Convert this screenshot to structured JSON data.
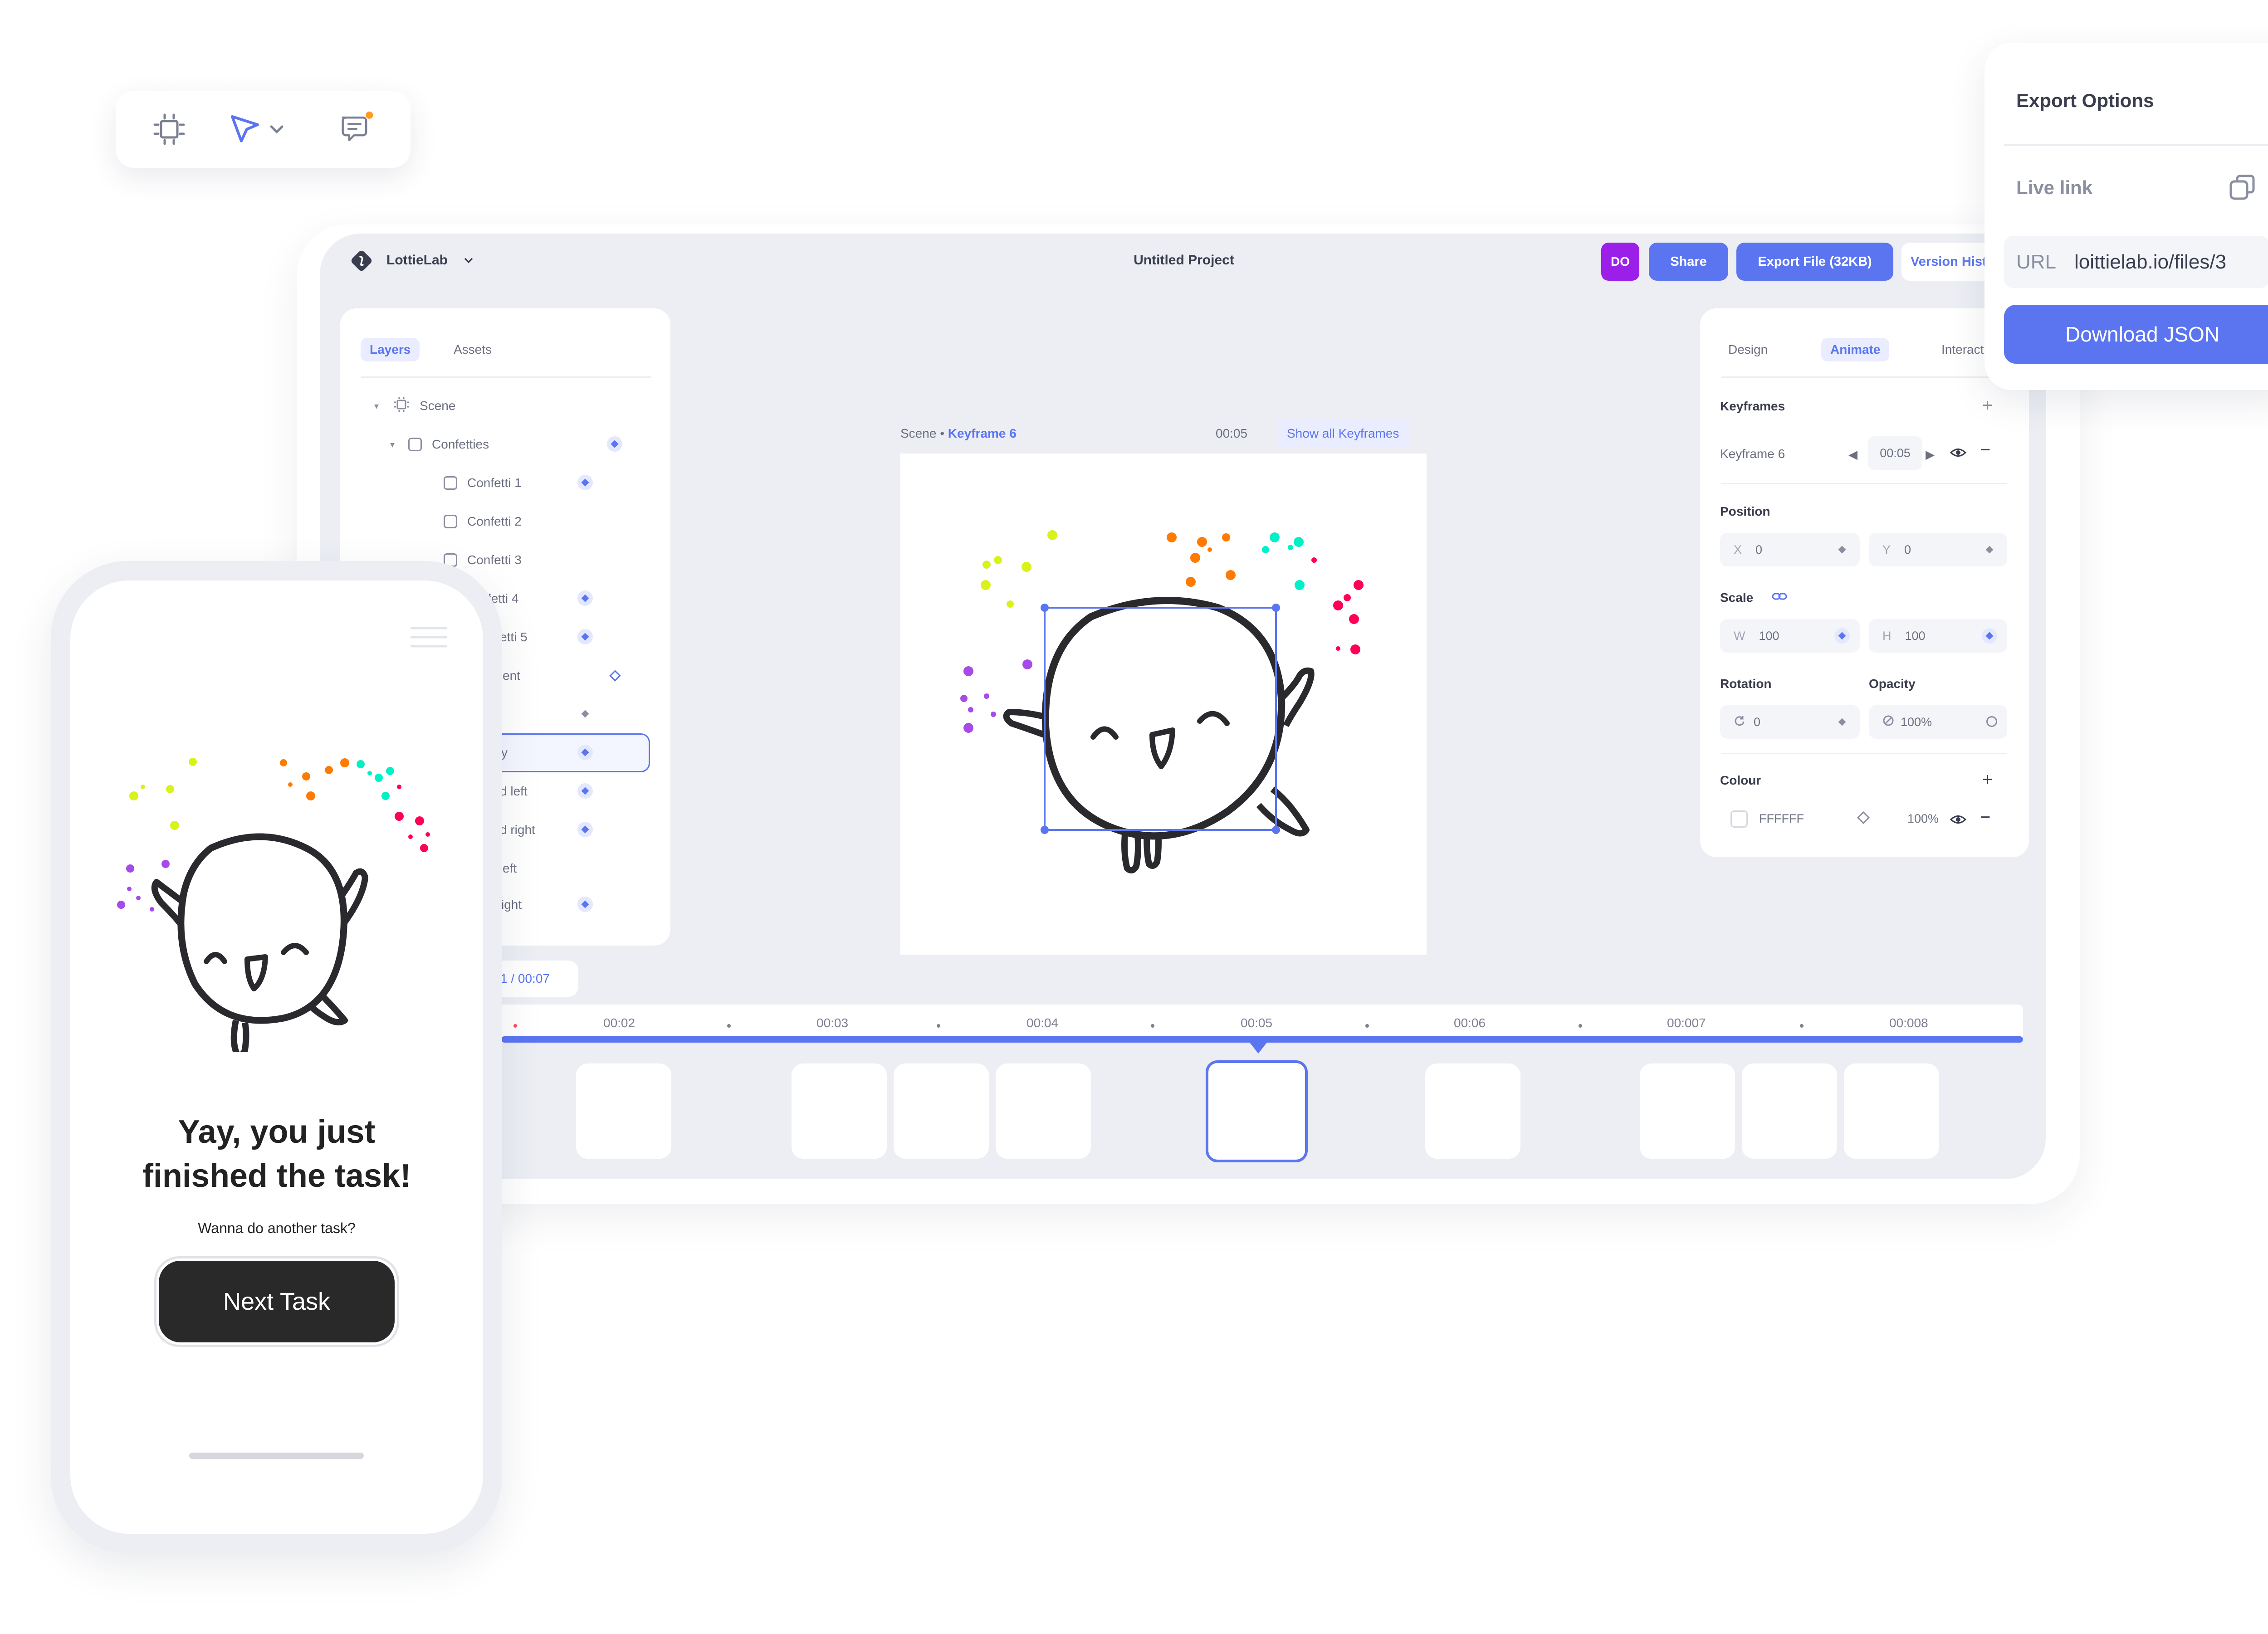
{
  "colors": {
    "accent": "#5b75f0",
    "avatar": "#9b1fe8",
    "panel_bg": "#eceef4",
    "dark_button": "#292929"
  },
  "float_toolbar": {
    "icons": [
      "frame-icon",
      "pointer-icon",
      "chevron-down-icon",
      "comment-icon"
    ]
  },
  "editor": {
    "app_name": "LottieLab",
    "project_title": "Untitled Project",
    "avatar_initials": "DO",
    "share_label": "Share",
    "export_label": "Export File (32KB)",
    "version_label": "Version History",
    "left_tabs": [
      "Layers",
      "Assets"
    ],
    "layers": [
      "Scene",
      "Confetties",
      "Confetti 1",
      "Confetti 2",
      "Confetti 3",
      "Confetti 4",
      "Confetti 5",
      "Parent",
      "",
      "Body",
      "Hand left",
      "Hand right",
      "Leg left",
      "Leg right"
    ],
    "layers_visible": [
      "Scene",
      "Confetties",
      "Confetti 1",
      "Confetti 2",
      "Confetti 3",
      "fetti 4",
      "etti 5",
      "ent",
      "",
      "y",
      "d left",
      "d right",
      "eft",
      "ight"
    ],
    "canvas": {
      "scene_label": "Scene",
      "keyframe_label": "Keyframe 6",
      "time": "00:05",
      "show_all_label": "Show all Keyframes"
    },
    "right_tabs": [
      "Design",
      "Animate",
      "Interactions"
    ],
    "keyframes": {
      "title": "Keyframes",
      "name": "Keyframe 6",
      "time": "00:05"
    },
    "position": {
      "label": "Position",
      "x_key": "X",
      "x": "0",
      "y_key": "Y",
      "y": "0"
    },
    "scale": {
      "label": "Scale",
      "w_key": "W",
      "w": "100",
      "h_key": "H",
      "h": "100"
    },
    "rotation": {
      "label": "Rotation",
      "value": "0"
    },
    "opacity": {
      "label": "Opacity",
      "value": "100%"
    },
    "colour": {
      "label": "Colour",
      "hex": "FFFFFF",
      "alpha": "100%"
    },
    "timeline": {
      "counter": "1 / 00:07",
      "ticks": [
        "00:02",
        "00:03",
        "00:04",
        "00:05",
        "00:06",
        "00:007",
        "00:008"
      ],
      "playhead": "00:05"
    }
  },
  "export_popup": {
    "title": "Export Options",
    "live_link_label": "Live link",
    "url_key": "URL",
    "url_value": "loittielab.io/files/3",
    "download_label": "Download JSON"
  },
  "phone": {
    "headline_line1": "Yay, you just",
    "headline_line2": "finished the task!",
    "subtitle": "Wanna do another task?",
    "button_label": "Next Task"
  }
}
